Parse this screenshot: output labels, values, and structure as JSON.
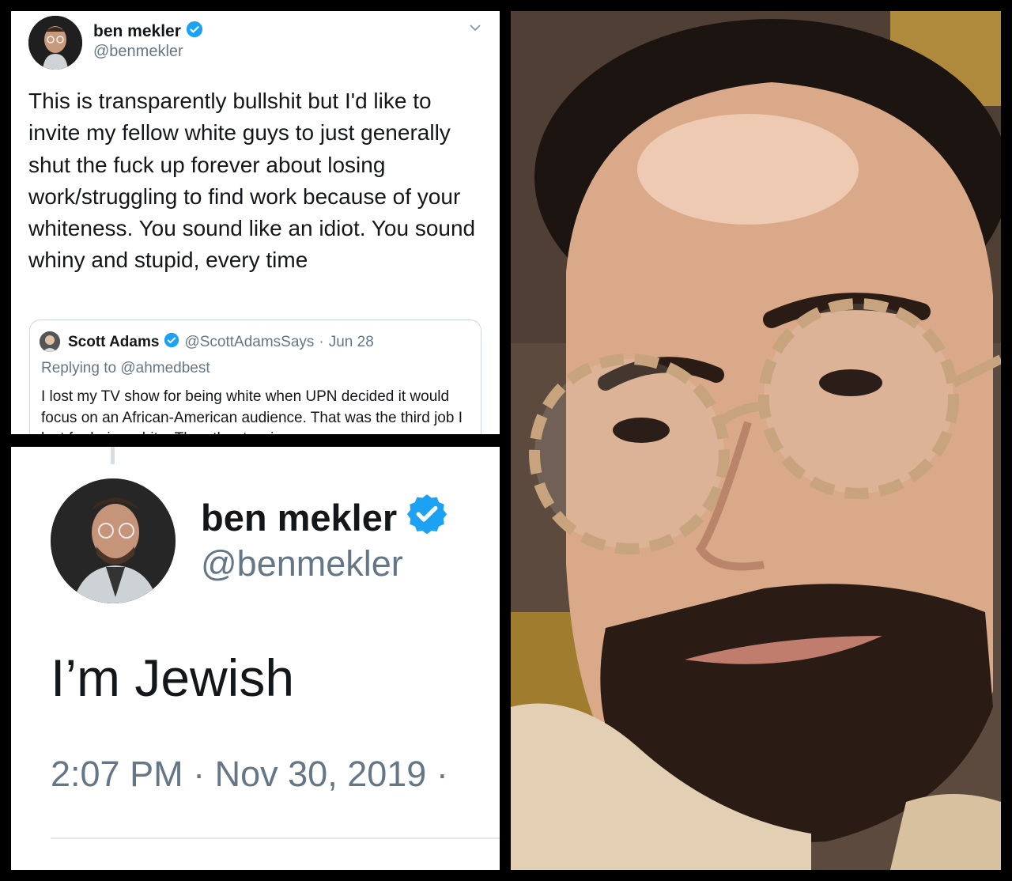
{
  "tweet1": {
    "author_name": "ben mekler",
    "author_handle": "@benmekler",
    "text": "This is transparently bullshit but I'd like to invite my fellow white guys to just generally shut the fuck up forever about losing work/struggling to find work because of your whiteness. You sound like an idiot. You sound whiny and stupid, every time",
    "quoted": {
      "author_name": "Scott Adams",
      "author_handle": "@ScottAdamsSays",
      "separator": "·",
      "date": "Jun 28",
      "replying_label": "Replying to",
      "replying_mention": "@ahmedbest",
      "text": "I lost my TV show for being white when UPN decided it would focus on an African-American audience. That was the third job I lost for being white. The other two in"
    }
  },
  "tweet2": {
    "author_name": "ben mekler",
    "author_handle": "@benmekler",
    "text": "I’m Jewish",
    "time": "2:07 PM",
    "separator": "·",
    "date": "Nov 30, 2019",
    "trailing": "·"
  },
  "icons": {
    "verified": "verified-badge-icon",
    "chevron": "chevron-down-icon"
  },
  "colors": {
    "verified_blue": "#1da1f2",
    "handle_gray": "#657786",
    "text_dark": "#14171a"
  }
}
